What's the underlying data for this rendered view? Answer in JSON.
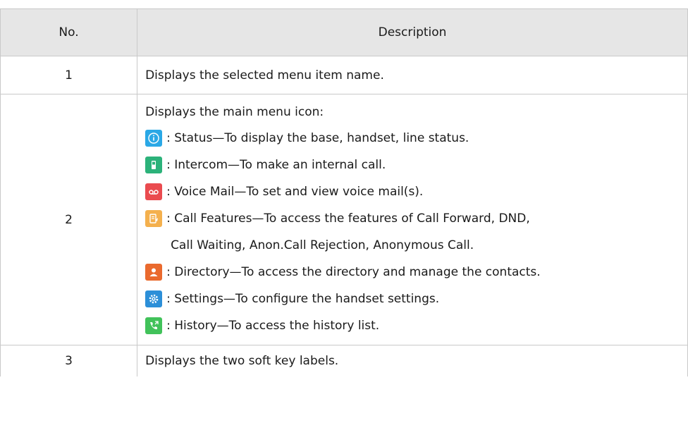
{
  "table": {
    "headers": [
      "No.",
      "Description"
    ],
    "rows": [
      {
        "no": "1",
        "description": "Displays the selected menu item name."
      },
      {
        "no": "2",
        "intro": "Displays the main menu icon:",
        "items": [
          {
            "icon": "status-info-icon",
            "color": "#2aa8e6",
            "text": ": Status—To display the base, handset, line status."
          },
          {
            "icon": "intercom-handset-icon",
            "color": "#2cb27a",
            "text": ": Intercom—To make an internal call."
          },
          {
            "icon": "voicemail-icon",
            "color": "#ea4b4f",
            "text": ": Voice Mail—To set and view voice mail(s)."
          },
          {
            "icon": "call-features-icon",
            "color": "#f4b04d",
            "text": ": Call Features—To access the features of Call Forward, DND,",
            "text2": "Call Waiting, Anon.Call Rejection, Anonymous Call."
          },
          {
            "icon": "directory-contact-icon",
            "color": "#ea6a2e",
            "text": ": Directory—To access the directory and manage the contacts."
          },
          {
            "icon": "settings-gear-icon",
            "color": "#2c8fd8",
            "text": ": Settings—To configure the handset settings."
          },
          {
            "icon": "history-call-icon",
            "color": "#41c25a",
            "text": ": History—To access the history list."
          }
        ]
      },
      {
        "no": "3",
        "description": "Displays the two soft key labels."
      }
    ]
  }
}
